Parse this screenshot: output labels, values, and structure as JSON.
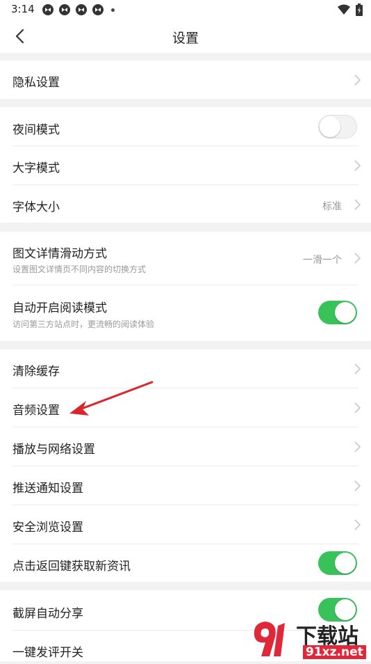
{
  "status": {
    "time": "3:14"
  },
  "header": {
    "title": "设置"
  },
  "sections": {
    "privacy": {
      "label": "隐私设置"
    },
    "night_mode": {
      "label": "夜间模式",
      "state": "off"
    },
    "large_text": {
      "label": "大字模式"
    },
    "font_size": {
      "label": "字体大小",
      "value": "标准"
    },
    "swipe_mode": {
      "label": "图文详情滑动方式",
      "sub": "设置图文详情页不同内容的切换方式",
      "value": "一滑一个"
    },
    "reading_mode": {
      "label": "自动开启阅读模式",
      "sub": "访问第三方站点时，更流畅的阅读体验",
      "state": "on"
    },
    "clear_cache": {
      "label": "清除缓存"
    },
    "audio": {
      "label": "音频设置"
    },
    "playback_network": {
      "label": "播放与网络设置"
    },
    "push": {
      "label": "推送通知设置"
    },
    "safe_browse": {
      "label": "安全浏览设置"
    },
    "back_refresh": {
      "label": "点击返回键获取新资讯",
      "state": "on"
    },
    "screenshot_share": {
      "label": "截屏自动分享",
      "state": "on"
    },
    "one_key_comment": {
      "label": "一键发评开关"
    }
  },
  "watermark": {
    "text1": "下载站",
    "text2": "91xz.net"
  },
  "colors": {
    "toggle_on": "#3ac25a",
    "arrow": "#d9262b"
  }
}
